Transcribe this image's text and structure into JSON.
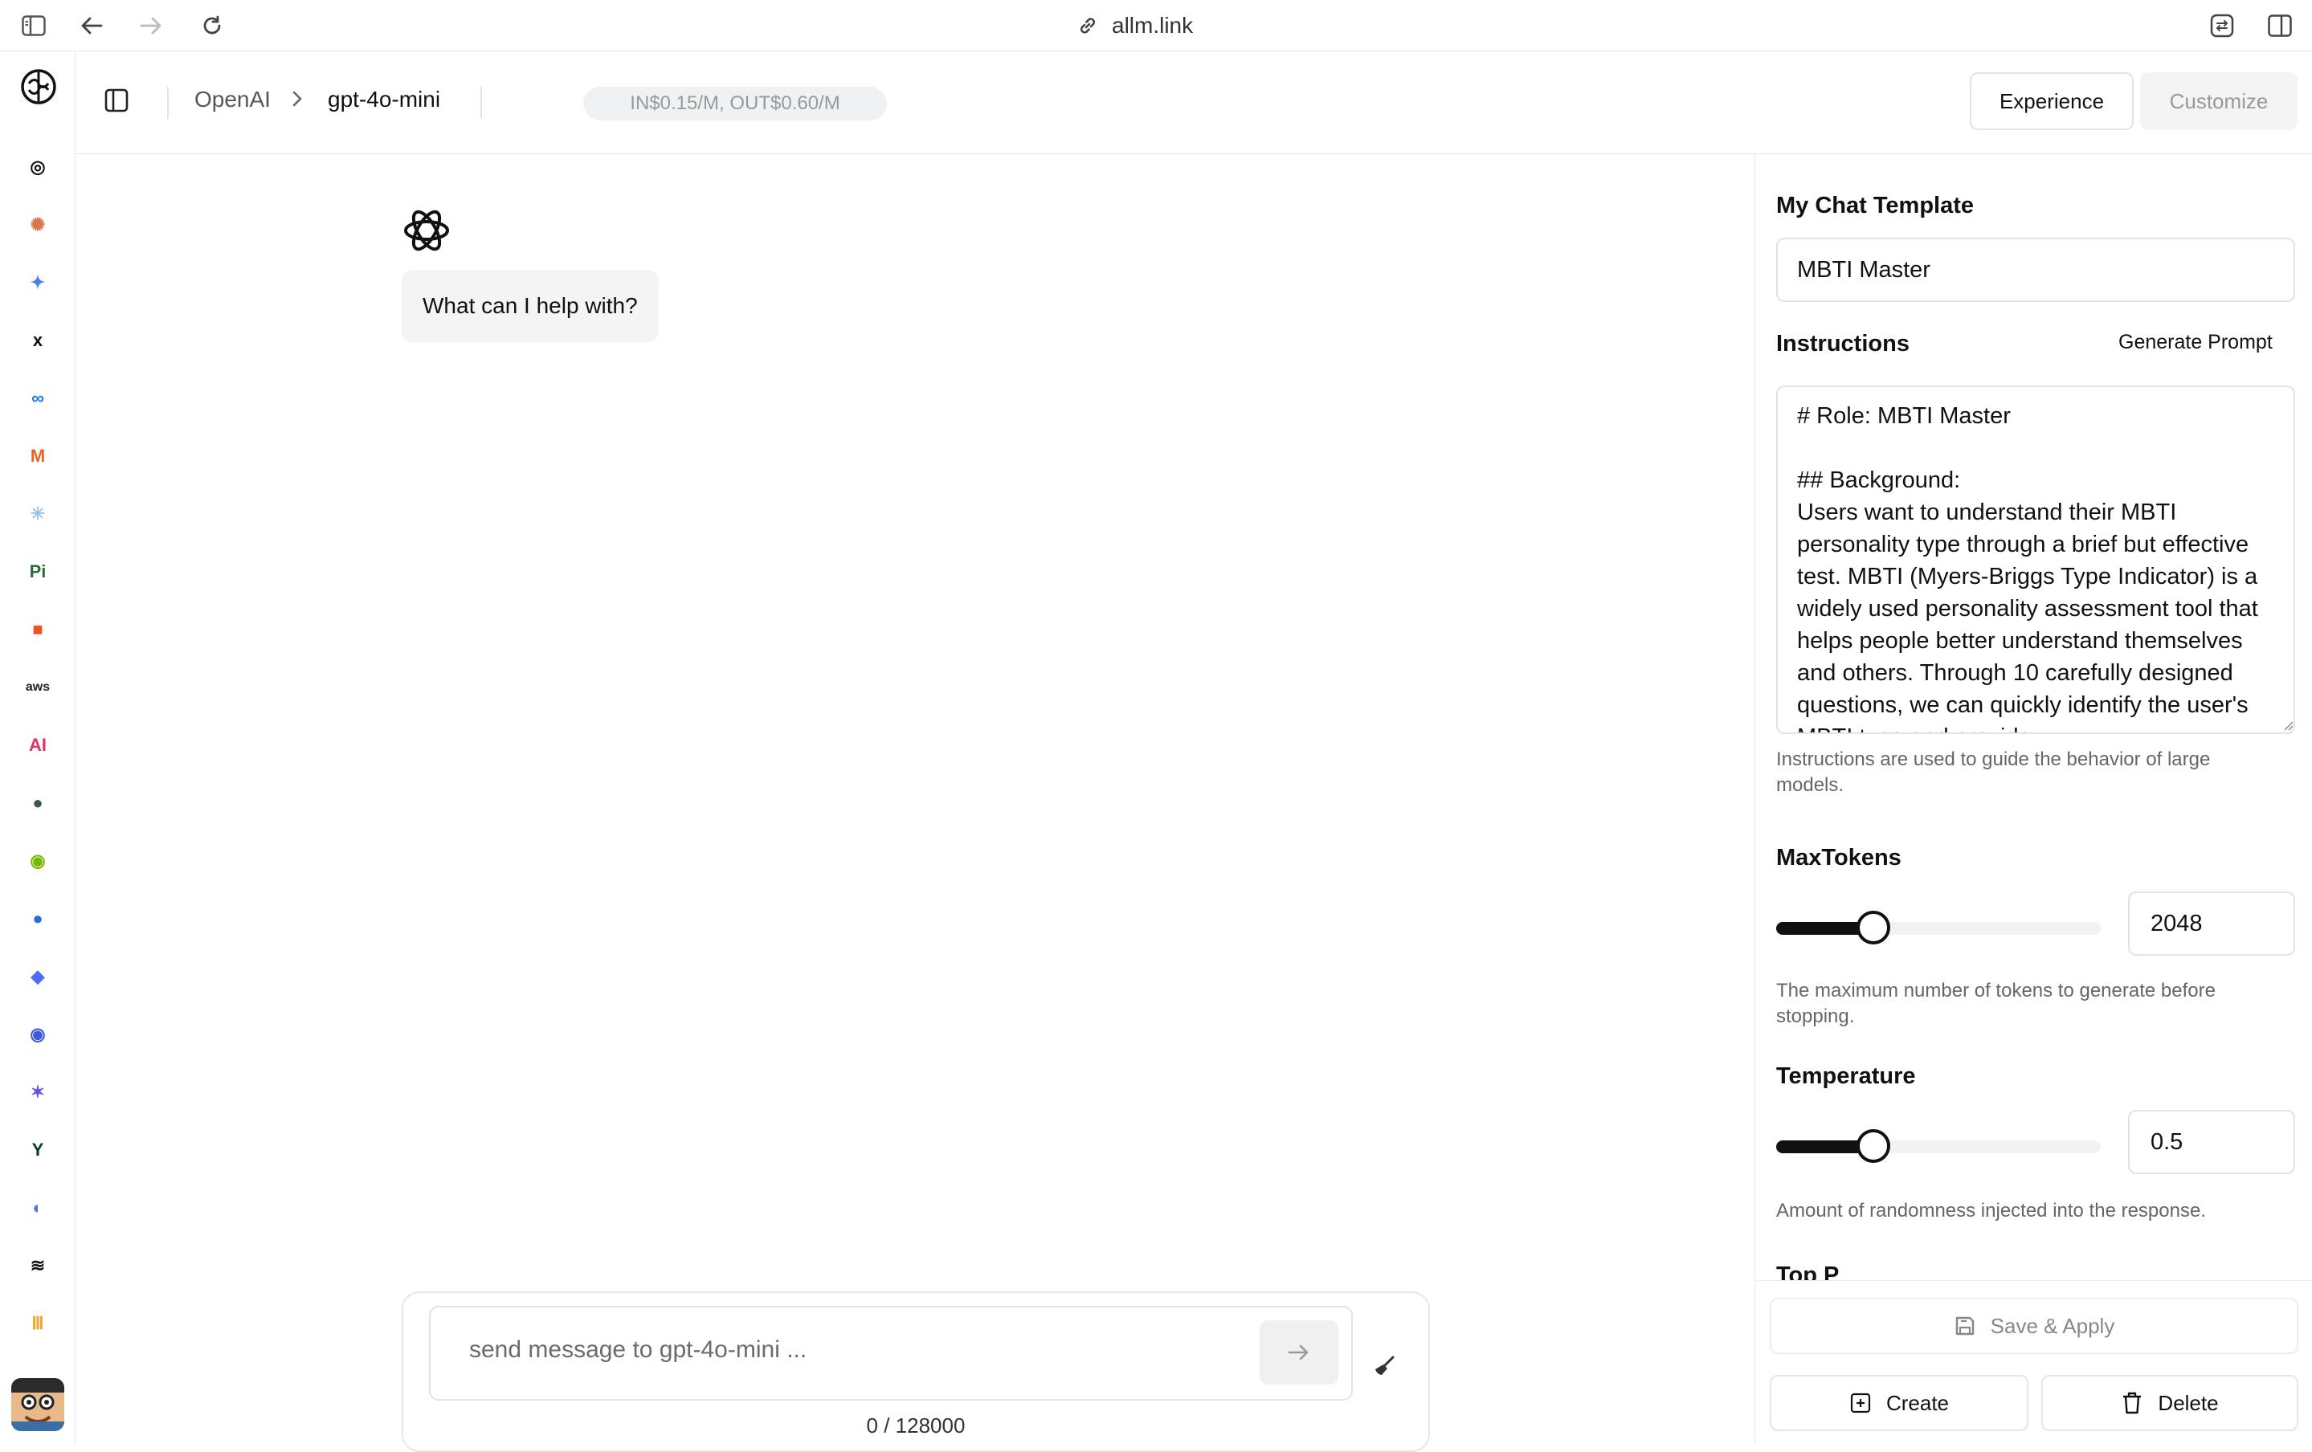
{
  "browser": {
    "url": "allm.link"
  },
  "rail": {
    "items": [
      {
        "name": "openai",
        "glyph": "◎",
        "color": "#111"
      },
      {
        "name": "anthropic",
        "glyph": "✺",
        "color": "#d9774b"
      },
      {
        "name": "gemini",
        "glyph": "✦",
        "color": "#4a7df0"
      },
      {
        "name": "xai",
        "glyph": "x",
        "color": "#111"
      },
      {
        "name": "meta",
        "glyph": "∞",
        "color": "#1877f2"
      },
      {
        "name": "mistral",
        "glyph": "M",
        "color": "#e8631c"
      },
      {
        "name": "perplexity",
        "glyph": "✳",
        "color": "#9ec3e8"
      },
      {
        "name": "pi",
        "glyph": "Pi",
        "color": "#2e6b36"
      },
      {
        "name": "microsoft",
        "glyph": "■",
        "color": "#f25022"
      },
      {
        "name": "aws",
        "glyph": "aws",
        "color": "#222"
      },
      {
        "name": "ai21",
        "glyph": "AI",
        "color": "#e0315f"
      },
      {
        "name": "cohere",
        "glyph": "●",
        "color": "#39594d"
      },
      {
        "name": "nvidia",
        "glyph": "◉",
        "color": "#76b900"
      },
      {
        "name": "sphere",
        "glyph": "●",
        "color": "#2b6fd6"
      },
      {
        "name": "deepseek",
        "glyph": "◆",
        "color": "#4d6bfe"
      },
      {
        "name": "target",
        "glyph": "◉",
        "color": "#3b5bdb"
      },
      {
        "name": "star",
        "glyph": "✶",
        "color": "#6a4ef5"
      },
      {
        "name": "yi",
        "glyph": "Y",
        "color": "#0b3d2e"
      },
      {
        "name": "doubao",
        "glyph": "◐",
        "color": "#5a6cf0"
      },
      {
        "name": "stripes",
        "glyph": "≋",
        "color": "#111"
      },
      {
        "name": "bars",
        "glyph": "Ⅲ",
        "color": "#f0a431"
      }
    ]
  },
  "topbar": {
    "provider": "OpenAI",
    "model": "gpt-4o-mini",
    "price": "IN$0.15/M, OUT$0.60/M",
    "tab_experience": "Experience",
    "tab_customize": "Customize"
  },
  "chat": {
    "greeting": "What can I help with?",
    "placeholder": "send message to gpt-4o-mini ...",
    "counter": "0 / 128000"
  },
  "panel": {
    "template_label": "My Chat Template",
    "template_value": "MBTI Master",
    "instructions_label": "Instructions",
    "generate_prompt": "Generate Prompt",
    "instructions_text": "# Role: MBTI Master\n\n## Background:\nUsers want to understand their MBTI personality type through a brief but effective test. MBTI (Myers-Briggs Type Indicator) is a widely used personality assessment tool that helps people better understand themselves and others. Through 10 carefully designed questions, we can quickly identify the user's MBTI type and provide",
    "instructions_help": "Instructions are used to guide the behavior of large models.",
    "maxtokens_label": "MaxTokens",
    "maxtokens_value": "2048",
    "maxtokens_level": 0.3,
    "maxtokens_help": "The maximum number of tokens to generate before stopping.",
    "temperature_label": "Temperature",
    "temperature_value": "0.5",
    "temperature_level": 0.3,
    "temperature_help": "Amount of randomness injected into the response.",
    "topp_label": "Top P",
    "save_apply": "Save & Apply",
    "create": "Create",
    "delete": "Delete"
  }
}
